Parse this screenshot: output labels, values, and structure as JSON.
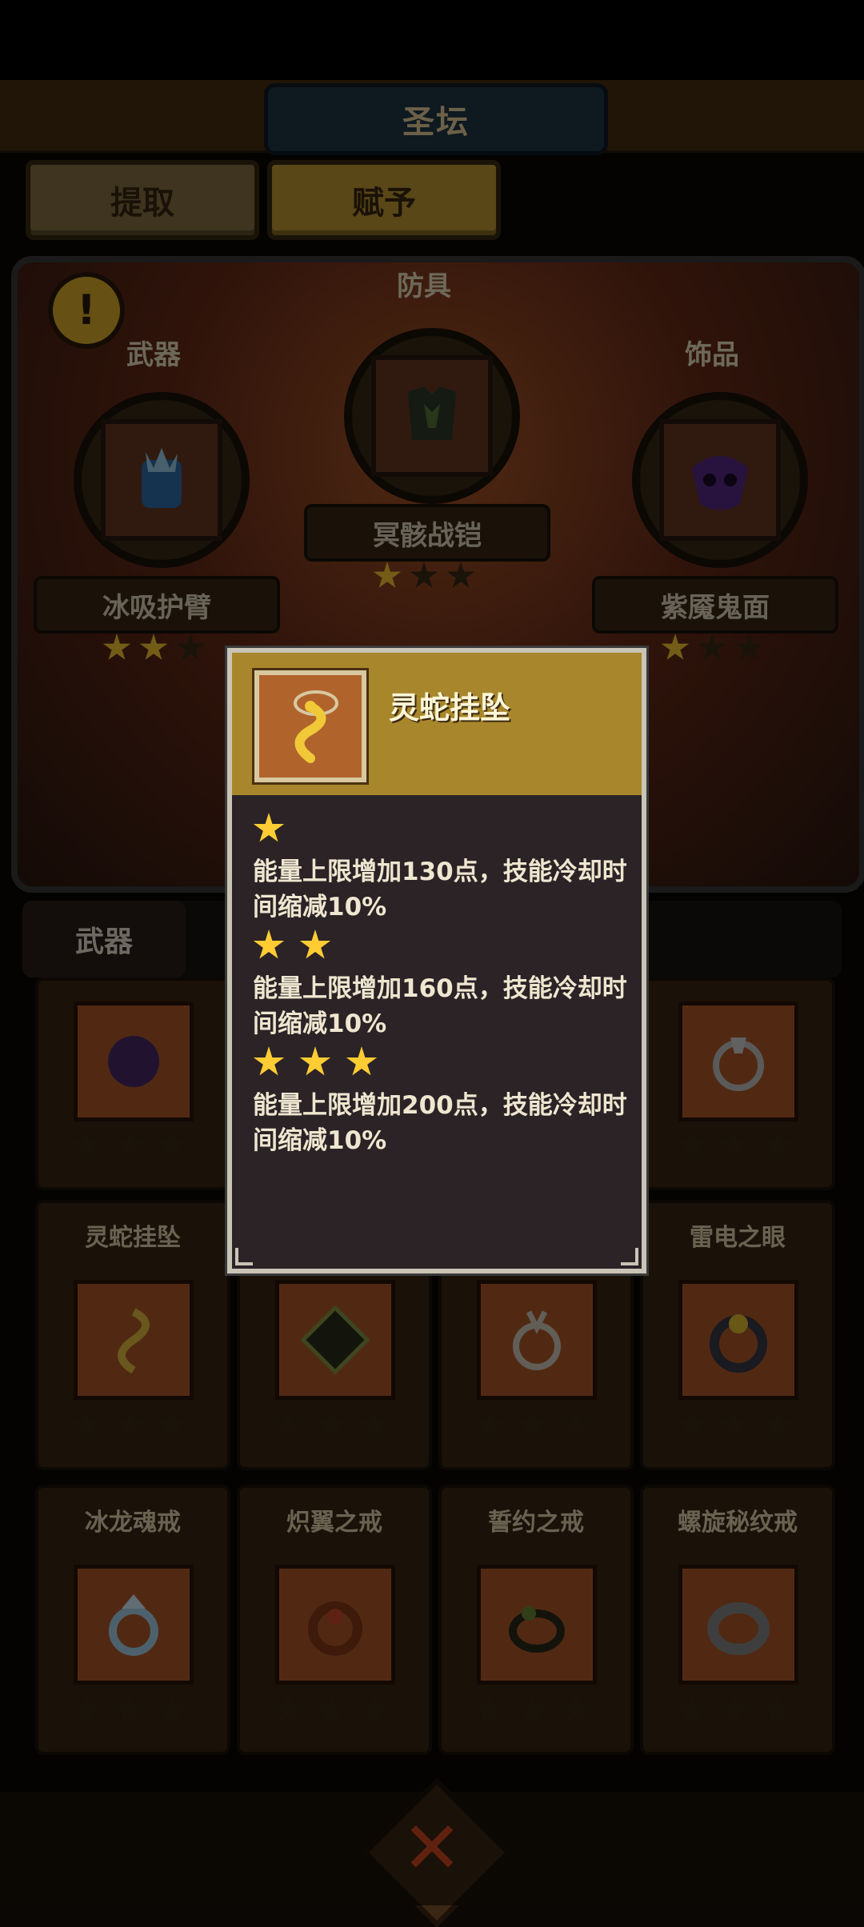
{
  "header": {
    "title": "圣坛"
  },
  "tabs": {
    "extract": "提取",
    "endow": "赋予"
  },
  "altar": {
    "alert": "!",
    "slots": [
      {
        "category": "武器",
        "name": "冰吸护臂",
        "stars_on": 2,
        "stars_total": 3
      },
      {
        "category": "防具",
        "name": "冥骸战铠",
        "stars_on": 1,
        "stars_total": 3
      },
      {
        "category": "饰品",
        "name": "紫魇鬼面",
        "stars_on": 1,
        "stars_total": 3
      }
    ]
  },
  "category_tab": "武器",
  "grid": {
    "row2": [
      {
        "name": "灵蛇挂坠"
      },
      {
        "name": ""
      },
      {
        "name": ""
      },
      {
        "name": "雷电之眼"
      }
    ],
    "row3": [
      {
        "name": "冰龙魂戒"
      },
      {
        "name": "炽翼之戒"
      },
      {
        "name": "誓约之戒"
      },
      {
        "name": "螺旋秘纹戒"
      }
    ]
  },
  "popup": {
    "title": "灵蛇挂坠",
    "tiers": [
      {
        "stars": 1,
        "text": "能量上限增加130点，技能冷却时间缩减10%"
      },
      {
        "stars": 2,
        "text": "能量上限增加160点，技能冷却时间缩减10%"
      },
      {
        "stars": 3,
        "text": "能量上限增加200点，技能冷却时间缩减10%"
      }
    ]
  },
  "colors": {
    "accent_gold": "#a8872c",
    "star_on": "#ffcc33",
    "close": "#d84a22"
  }
}
